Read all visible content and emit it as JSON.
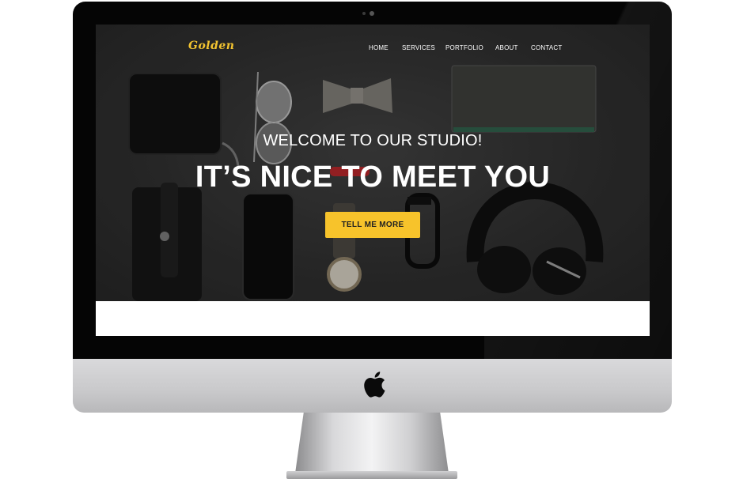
{
  "site": {
    "brand": "Golden",
    "nav": [
      "HOME",
      "SERVICES",
      "PORTFOLIO",
      "ABOUT",
      "CONTACT"
    ]
  },
  "hero": {
    "subtitle": "WELCOME TO OUR STUDIO!",
    "headline": "IT’S NICE TO MEET YOU",
    "cta_label": "TELL ME MORE"
  },
  "colors": {
    "accent": "#f7c32b",
    "brand_text": "#f2c330",
    "hero_background": "#2f2f2f",
    "bezel": "#050505"
  },
  "icons": [
    "apple-logo-icon",
    "camera-icon"
  ]
}
